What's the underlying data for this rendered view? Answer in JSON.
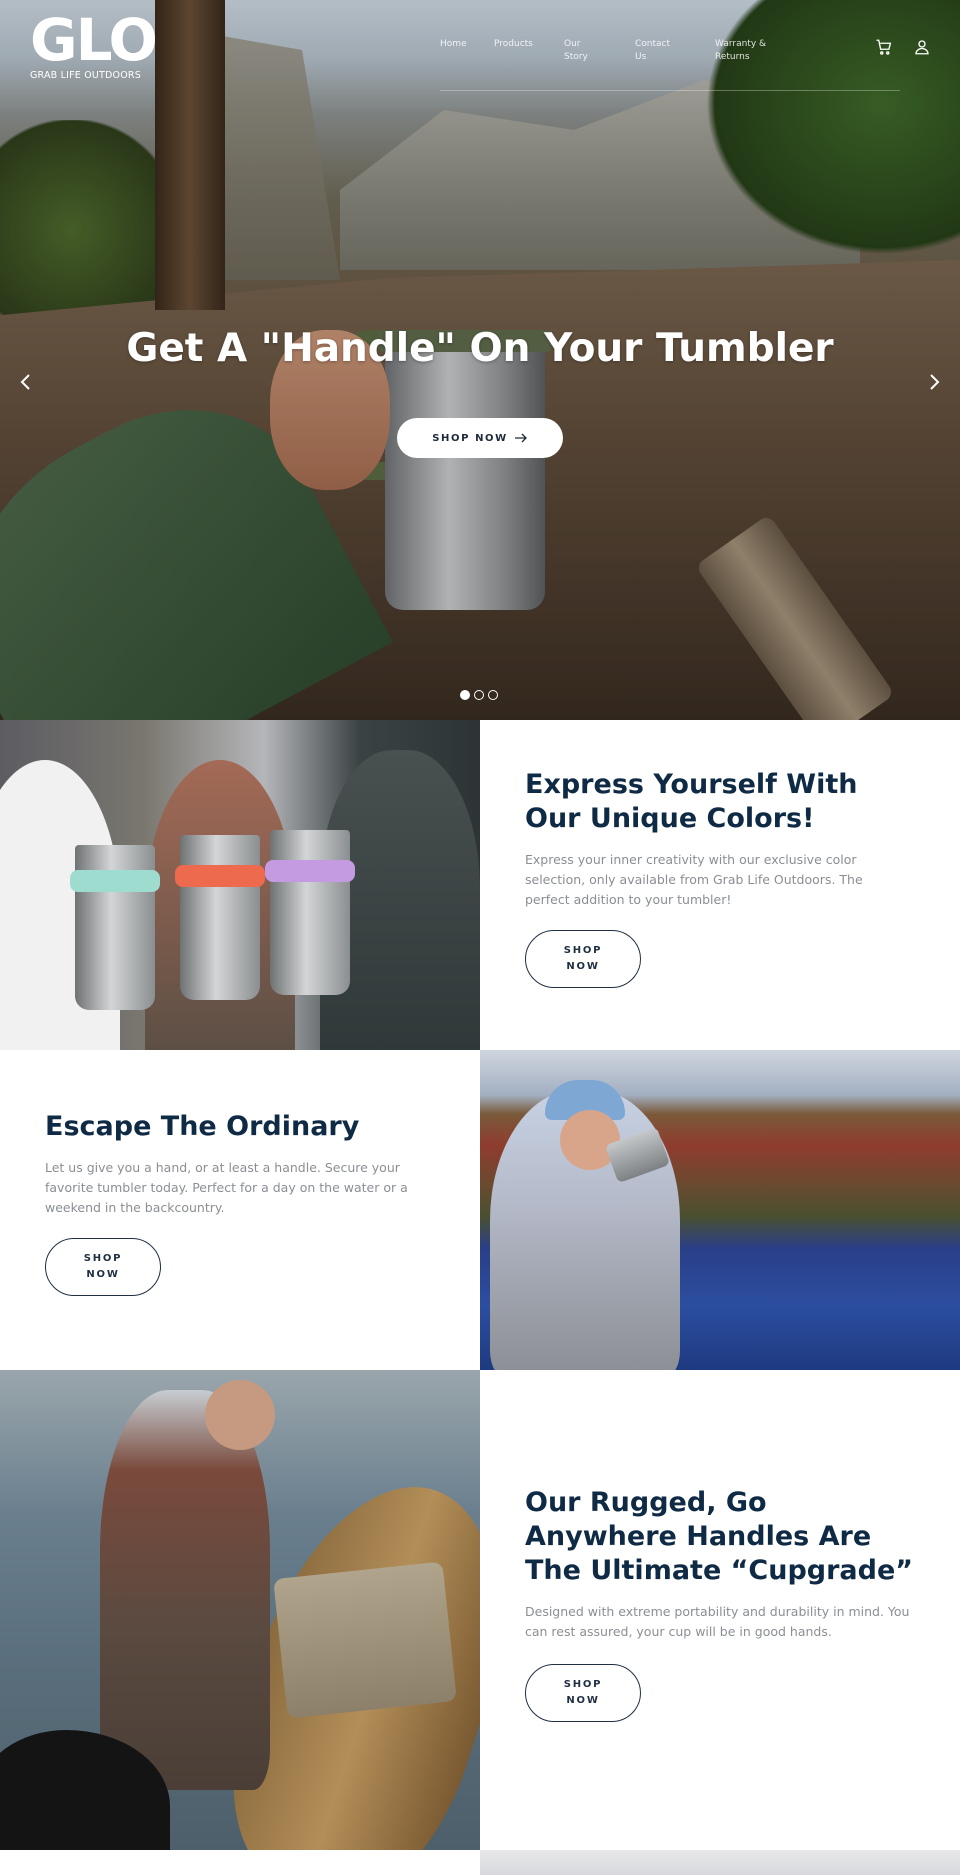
{
  "header": {
    "logo_mark": "GLO",
    "logo_sub": "GRAB LIFE OUTDOORS",
    "nav": [
      {
        "label": "Home"
      },
      {
        "label": "Products"
      },
      {
        "label": "Our Story"
      },
      {
        "label": "Contact Us"
      },
      {
        "label": "Warranty & Returns"
      }
    ]
  },
  "hero": {
    "title": "Get A \"Handle\" On Your Tumbler",
    "button": "SHOP NOW",
    "slides": 3,
    "active_slide": 1
  },
  "sections": [
    {
      "title": "Express Yourself With Our Unique Colors!",
      "body": "Express your inner creativity with our exclusive color selection, only available from Grab Life Outdoors. The perfect addition to your tumbler!",
      "button": "SHOP NOW"
    },
    {
      "title": "Escape The Ordinary",
      "body": "Let us give you a hand, or at least a handle. Secure your favorite tumbler today. Perfect for a day on the water or a weekend in the backcountry.",
      "button": "SHOP NOW"
    },
    {
      "title": "Our Rugged, Go Anywhere Handles Are The Ultimate “Cupgrade”",
      "body": "Designed with extreme portability and durability in mind. You can rest assured, your cup will be in good hands.",
      "button": "SHOP NOW"
    }
  ],
  "colors": {
    "heading": "#0f2a44",
    "body_text": "#8a8f95",
    "button_border": "#1f2f42"
  },
  "icons": [
    "cart-icon",
    "user-icon",
    "chevron-left-icon",
    "chevron-right-icon",
    "arrow-right-icon"
  ]
}
